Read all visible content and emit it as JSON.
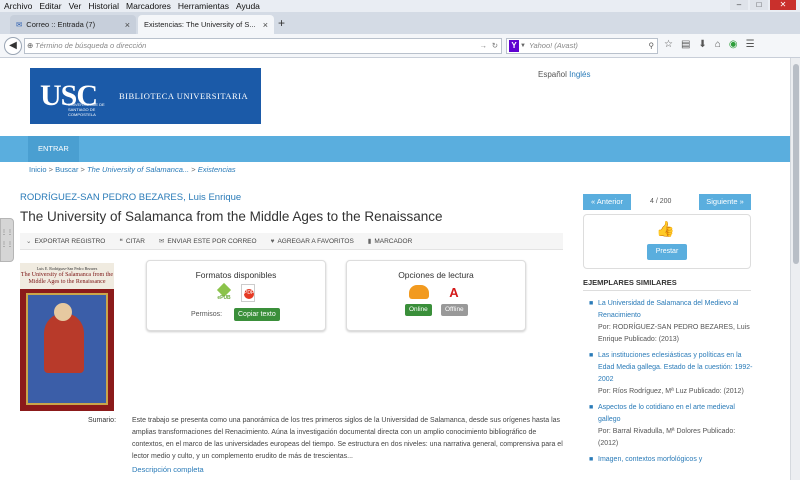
{
  "menu": [
    "Archivo",
    "Editar",
    "Ver",
    "Historial",
    "Marcadores",
    "Herramientas",
    "Ayuda"
  ],
  "window_controls": {
    "minimize": "–",
    "maximize": "□",
    "close": "✕"
  },
  "tabs": [
    {
      "label": "Correo :: Entrada (7)",
      "close": "×"
    },
    {
      "label": "Existencias: The University of S...",
      "close": "×"
    }
  ],
  "new_tab": "+",
  "nav": {
    "back": "◀",
    "url_placeholder": "Término de búsqueda o dirección",
    "search_placeholder": "Yahoo! (Avast)",
    "yahoo_letter": "Y"
  },
  "header": {
    "logo_text": "USC",
    "logo_sub": "UNIVERSIDADE DE SANTIAGO DE COMPOSTELA",
    "library_name": "BIBLIOTECA UNIVERSITARIA",
    "lang_es": "Español",
    "lang_en": "Inglés"
  },
  "bluebar": {
    "login": "ENTRAR"
  },
  "breadcrumb": {
    "home": "Inicio",
    "search": "Buscar",
    "record": "The University of Salamanca...",
    "current": "Existencias",
    "sep": ">"
  },
  "record": {
    "author": "RODRÍGUEZ-SAN PEDRO BEZARES, Luis Enrique",
    "title": "The University of Salamanca from the Middle Ages to the Renaissance"
  },
  "actions": {
    "export": "EXPORTAR REGISTRO",
    "cite": "CITAR",
    "email": "ENVIAR ESTE POR CORREO",
    "favorites": "AGREGAR A FAVORITOS",
    "bookmark": "MARCADOR"
  },
  "cover": {
    "author": "Luis E. Rodríguez-San Pedro Bezares",
    "title": "The University of Salamanca from the Middle Ages to the Renaissance"
  },
  "formats": {
    "heading": "Formatos disponibles",
    "epub_label": "ePUB",
    "pdf_label": "PDF",
    "perm_label": "Permisos:",
    "copy_label": "Copiar texto"
  },
  "reading": {
    "heading": "Opciones de lectura",
    "adobe_label": "Adobe",
    "online": "Online",
    "offline": "Offline"
  },
  "summary": {
    "label": "Sumario:",
    "text": "Este trabajo se presenta como una panorámica de los tres primeros siglos de la Universidad de Salamanca, desde sus orígenes hasta las amplias transformaciones del Renacimiento. Aúna la investigación documental directa con un amplio conocimiento bibliográfico de contextos, en el marco de las universidades europeas del tiempo. Se estructura en dos niveles: una narrativa general, comprensiva para el lector medio y culto, y un complemento erudito de más de trescientas...",
    "more": "Descripción completa"
  },
  "pager": {
    "prev": "« Anterior",
    "count": "4 / 200",
    "next": "Siguiente »"
  },
  "lend": {
    "button": "Prestar"
  },
  "similar": {
    "heading": "EJEMPLARES SIMILARES",
    "items": [
      {
        "title": "La Universidad de Salamanca del Medievo al Renacimiento",
        "meta": "Por: RODRÍGUEZ-SAN PEDRO BEZARES, Luis Enrique Publicado: (2013)"
      },
      {
        "title": "Las instituciones eclesiásticas y políticas en la Edad Media gallega. Estado de la cuestión: 1992-2002",
        "meta": "Por: Ríos Rodríguez, Mª Luz Publicado: (2012)"
      },
      {
        "title": "Aspectos de lo cotidiano en el arte medieval gallego",
        "meta": "Por: Barral Rivadulla, Mª Dolores Publicado: (2012)"
      },
      {
        "title": "Imagen, contextos morfológicos y",
        "meta": ""
      }
    ]
  }
}
